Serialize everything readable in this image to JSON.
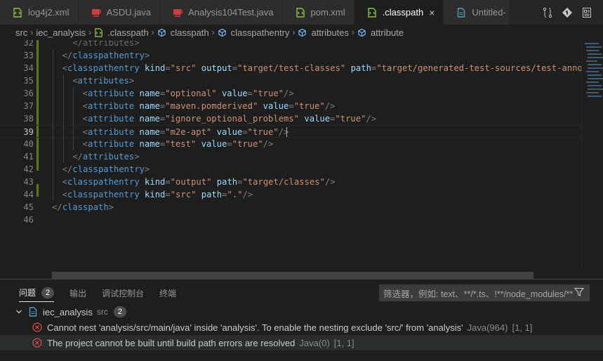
{
  "tabs": [
    {
      "label": "log4j2.xml",
      "icon": "xml-file-icon",
      "active": false
    },
    {
      "label": "ASDU.java",
      "icon": "java-file-icon",
      "active": false
    },
    {
      "label": "Analysis104Test.java",
      "icon": "java-file-icon",
      "active": false
    },
    {
      "label": "pom.xml",
      "icon": "xml-file-icon",
      "active": false
    },
    {
      "label": ".classpath",
      "icon": "xml-file-icon",
      "active": true,
      "close": "×"
    },
    {
      "label": "Untitled-",
      "icon": "plain-file-icon",
      "active": false
    }
  ],
  "breadcrumb": [
    "src",
    "iec_analysis",
    ".classpath",
    "classpath",
    "classpathentry",
    "attributes",
    "attribute"
  ],
  "editor": {
    "lines": [
      {
        "n": "32",
        "partial": true,
        "text": "</attributes>"
      },
      {
        "n": "33",
        "indent": 1,
        "parts": [
          [
            "br",
            "</"
          ],
          [
            "tag",
            "classpathentry"
          ],
          [
            "br",
            ">"
          ]
        ]
      },
      {
        "n": "34",
        "indent": 1,
        "parts": [
          [
            "br",
            "<"
          ],
          [
            "tag",
            "classpathentry"
          ],
          [
            "ws",
            " "
          ],
          [
            "attr",
            "kind"
          ],
          [
            "br",
            "="
          ],
          [
            "str",
            "\"src\""
          ],
          [
            "ws",
            " "
          ],
          [
            "attr",
            "output"
          ],
          [
            "br",
            "="
          ],
          [
            "str",
            "\"target/test-classes\""
          ],
          [
            "ws",
            " "
          ],
          [
            "attr",
            "path"
          ],
          [
            "br",
            "="
          ],
          [
            "str",
            "\"target/generated-test-sources/test-annota"
          ]
        ]
      },
      {
        "n": "35",
        "indent": 2,
        "parts": [
          [
            "br",
            "<"
          ],
          [
            "tag",
            "attributes"
          ],
          [
            "br",
            ">"
          ]
        ]
      },
      {
        "n": "36",
        "indent": 3,
        "parts": [
          [
            "br",
            "<"
          ],
          [
            "tag",
            "attribute"
          ],
          [
            "ws",
            " "
          ],
          [
            "attr",
            "name"
          ],
          [
            "br",
            "="
          ],
          [
            "str",
            "\"optional\""
          ],
          [
            "ws",
            " "
          ],
          [
            "attr",
            "value"
          ],
          [
            "br",
            "="
          ],
          [
            "str",
            "\"true\""
          ],
          [
            "br",
            "/>"
          ]
        ]
      },
      {
        "n": "37",
        "indent": 3,
        "parts": [
          [
            "br",
            "<"
          ],
          [
            "tag",
            "attribute"
          ],
          [
            "ws",
            " "
          ],
          [
            "attr",
            "name"
          ],
          [
            "br",
            "="
          ],
          [
            "str",
            "\"maven.pomderived\""
          ],
          [
            "ws",
            " "
          ],
          [
            "attr",
            "value"
          ],
          [
            "br",
            "="
          ],
          [
            "str",
            "\"true\""
          ],
          [
            "br",
            "/>"
          ]
        ]
      },
      {
        "n": "38",
        "indent": 3,
        "parts": [
          [
            "br",
            "<"
          ],
          [
            "tag",
            "attribute"
          ],
          [
            "ws",
            " "
          ],
          [
            "attr",
            "name"
          ],
          [
            "br",
            "="
          ],
          [
            "str",
            "\"ignore_optional_problems\""
          ],
          [
            "ws",
            " "
          ],
          [
            "attr",
            "value"
          ],
          [
            "br",
            "="
          ],
          [
            "str",
            "\"true\""
          ],
          [
            "br",
            "/>"
          ]
        ]
      },
      {
        "n": "39",
        "indent": 3,
        "current": true,
        "parts": [
          [
            "br",
            "<"
          ],
          [
            "tag",
            "attribute"
          ],
          [
            "ws",
            " "
          ],
          [
            "attr",
            "name"
          ],
          [
            "br",
            "="
          ],
          [
            "str",
            "\"m2e-apt\""
          ],
          [
            "ws",
            " "
          ],
          [
            "attr",
            "value"
          ],
          [
            "br",
            "="
          ],
          [
            "str",
            "\"true\""
          ],
          [
            "br",
            "/>"
          ]
        ]
      },
      {
        "n": "40",
        "indent": 3,
        "parts": [
          [
            "br",
            "<"
          ],
          [
            "tag",
            "attribute"
          ],
          [
            "ws",
            " "
          ],
          [
            "attr",
            "name"
          ],
          [
            "br",
            "="
          ],
          [
            "str",
            "\"test\""
          ],
          [
            "ws",
            " "
          ],
          [
            "attr",
            "value"
          ],
          [
            "br",
            "="
          ],
          [
            "str",
            "\"true\""
          ],
          [
            "br",
            "/>"
          ]
        ]
      },
      {
        "n": "41",
        "indent": 2,
        "parts": [
          [
            "br",
            "</"
          ],
          [
            "tag",
            "attributes"
          ],
          [
            "br",
            ">"
          ]
        ]
      },
      {
        "n": "42",
        "indent": 1,
        "parts": [
          [
            "br",
            "</"
          ],
          [
            "tag",
            "classpathentry"
          ],
          [
            "br",
            ">"
          ]
        ]
      },
      {
        "n": "43",
        "indent": 1,
        "parts": [
          [
            "br",
            "<"
          ],
          [
            "tag",
            "classpathentry"
          ],
          [
            "ws",
            " "
          ],
          [
            "attr",
            "kind"
          ],
          [
            "br",
            "="
          ],
          [
            "str",
            "\"output\""
          ],
          [
            "ws",
            " "
          ],
          [
            "attr",
            "path"
          ],
          [
            "br",
            "="
          ],
          [
            "str",
            "\"target/classes\""
          ],
          [
            "br",
            "/>"
          ]
        ]
      },
      {
        "n": "44",
        "indent": 1,
        "parts": [
          [
            "br",
            "<"
          ],
          [
            "tag",
            "classpathentry"
          ],
          [
            "ws",
            " "
          ],
          [
            "attr",
            "kind"
          ],
          [
            "br",
            "="
          ],
          [
            "str",
            "\"src\""
          ],
          [
            "ws",
            " "
          ],
          [
            "attr",
            "path"
          ],
          [
            "br",
            "="
          ],
          [
            "str",
            "\".\""
          ],
          [
            "br",
            "/>"
          ]
        ]
      },
      {
        "n": "45",
        "indent": 0,
        "parts": [
          [
            "br",
            "</"
          ],
          [
            "tag",
            "classpath"
          ],
          [
            "br",
            ">"
          ]
        ]
      },
      {
        "n": "46",
        "indent": 0,
        "parts": []
      }
    ]
  },
  "panel": {
    "tabs": [
      {
        "label": "问题",
        "badge": "2",
        "active": true
      },
      {
        "label": "输出",
        "active": false
      },
      {
        "label": "调试控制台",
        "active": false
      },
      {
        "label": "终端",
        "active": false
      }
    ],
    "filter_placeholder": "筛选器，例如: text、**/*.ts、!**/node_modules/**",
    "group": {
      "name": "iec_analysis",
      "src": "src",
      "count": "2"
    },
    "problems": [
      {
        "message": "Cannot nest 'analysis/src/main/java' inside 'analysis'. To enable the nesting exclude 'src/' from 'analysis'",
        "source": "Java(964)",
        "pos": "[1, 1]"
      },
      {
        "message": "The project cannot be built until build path errors are resolved",
        "source": "Java(0)",
        "pos": "[1, 1]"
      }
    ]
  },
  "colors": {
    "error": "#f14c4c",
    "xml_icon": "#8dc149",
    "java_icon": "#cc3e44",
    "file_icon": "#519aba"
  }
}
